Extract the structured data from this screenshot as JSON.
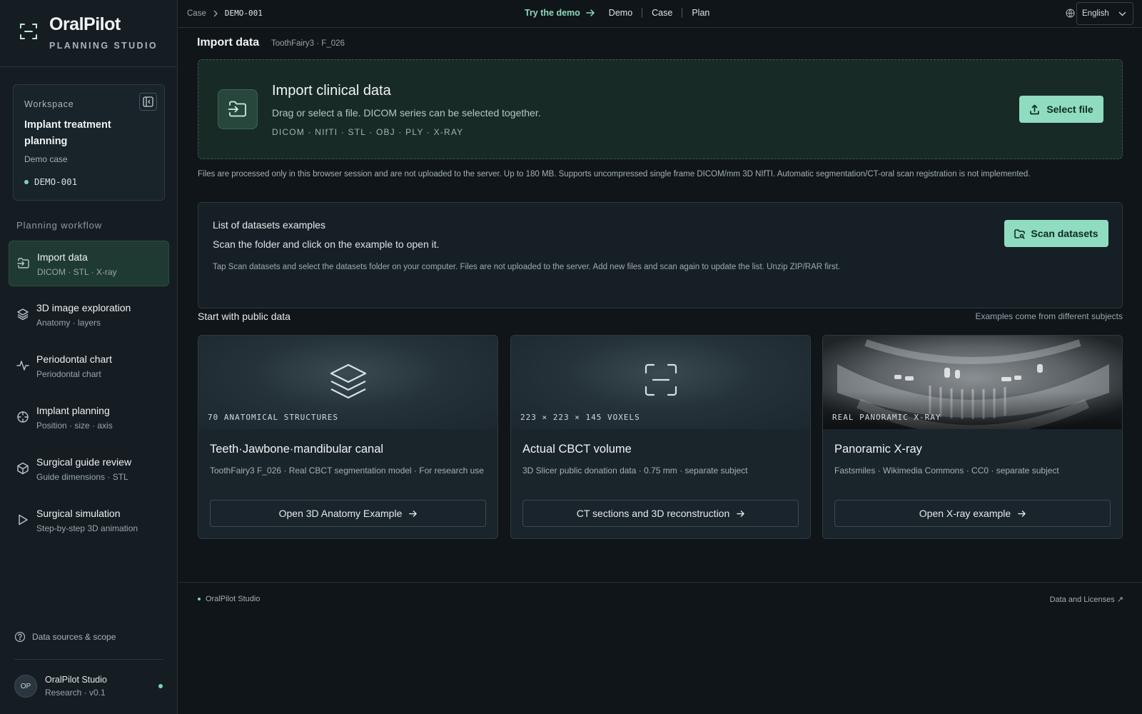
{
  "brand": {
    "title": "OralPilot",
    "subtitle": "PLANNING STUDIO"
  },
  "workspace": {
    "label": "Workspace",
    "title": "Implant treatment planning",
    "case": "Demo case",
    "case_id": "DEMO-001"
  },
  "workflow": {
    "heading": "Planning workflow",
    "items": [
      {
        "title": "Import data",
        "sub": "DICOM · STL · X-ray",
        "icon": "import-icon",
        "active": true
      },
      {
        "title": "3D image exploration",
        "sub": "Anatomy · layers",
        "icon": "layers-icon"
      },
      {
        "title": "Periodontal chart",
        "sub": "Periodontal chart",
        "icon": "pulse-icon"
      },
      {
        "title": "Implant planning",
        "sub": "Position · size · axis",
        "icon": "crosshair-icon"
      },
      {
        "title": "Surgical guide review",
        "sub": "Guide dimensions · STL",
        "icon": "cube-icon"
      },
      {
        "title": "Surgical simulation",
        "sub": "Step-by-step 3D animation",
        "icon": "play-icon"
      }
    ]
  },
  "sidebar_footer": {
    "sources": "Data sources & scope",
    "avatar": "OP",
    "user_name": "OralPilot Studio",
    "user_version": "Research · v0.1"
  },
  "topbar": {
    "breadcrumb_root": "Case",
    "breadcrumb_current": "DEMO-001",
    "try_demo": "Try the demo",
    "nav": [
      "Demo",
      "Case",
      "Plan"
    ],
    "language": "English"
  },
  "main": {
    "title": "Import data",
    "meta": "ToothFairy3 · F_026"
  },
  "import": {
    "title": "Import clinical data",
    "desc": "Drag or select a file. DICOM series can be selected together.",
    "formats": "DICOM · NIfTI · STL · OBJ · PLY · X-RAY",
    "button": "Select file"
  },
  "notice": "Files are processed only in this browser session and are not uploaded to the server. Up to 180 MB. Supports uncompressed single frame DICOM/mm 3D NIfTI. Automatic segmentation/CT-oral scan registration is not implemented.",
  "datasets": {
    "title": "List of datasets examples",
    "desc": "Scan the folder and click on the example to open it.",
    "hint": "Tap Scan datasets and select the datasets folder on your computer. Files are not uploaded to the server. Add new files and scan again to update the list. Unzip ZIP/RAR first.",
    "button": "Scan datasets"
  },
  "public": {
    "title": "Start with public data",
    "note": "Examples come from different subjects",
    "cards": [
      {
        "tag": "70 ANATOMICAL STRUCTURES",
        "title": "Teeth·Jawbone·mandibular canal",
        "desc": "ToothFairy3 F_026 · Real CBCT segmentation model · For research use",
        "button": "Open 3D Anatomy Example"
      },
      {
        "tag": "223 × 223 × 145 VOXELS",
        "title": "Actual CBCT volume",
        "desc": "3D Slicer public donation data · 0.75 mm · separate subject",
        "button": "CT sections and 3D reconstruction"
      },
      {
        "tag": "REAL PANORAMIC X-RAY",
        "title": "Panoramic X-ray",
        "desc": "Fastsmiles · Wikimedia Commons · CC0 · separate subject",
        "button": "Open X-ray example"
      }
    ]
  },
  "footer": {
    "left": "OralPilot Studio",
    "right": "Data and Licenses ↗"
  },
  "colors": {
    "accent": "#8fdcc1",
    "active_nav": "#1f3a32",
    "background": "#0f1519"
  }
}
